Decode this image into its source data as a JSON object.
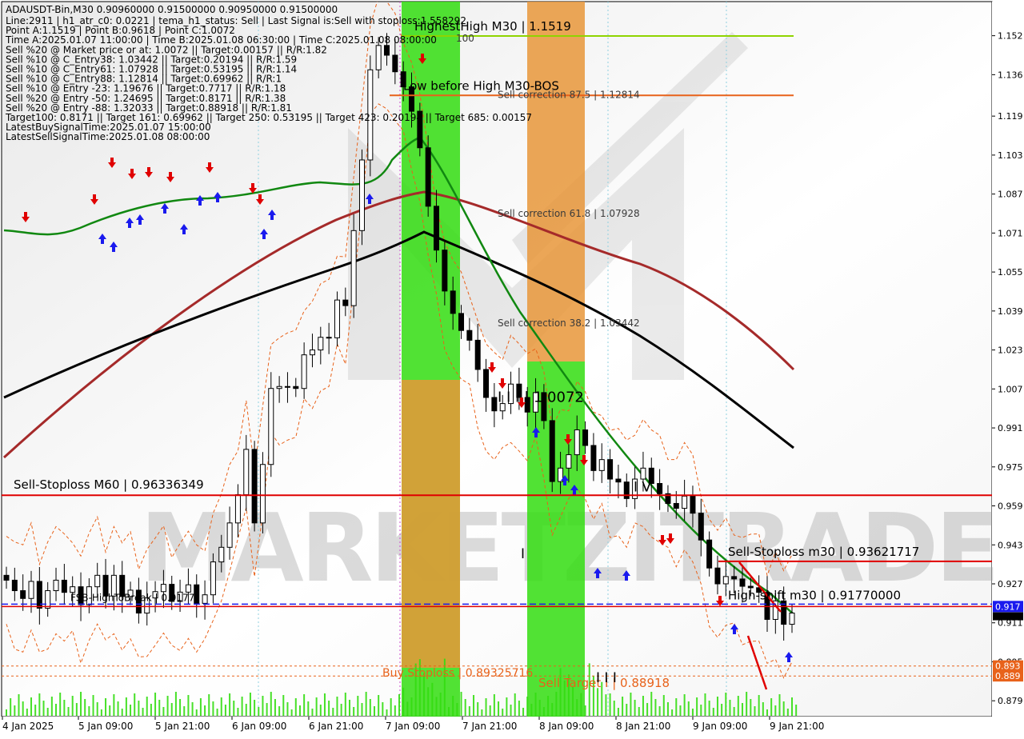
{
  "chart_data": {
    "type": "candlestick",
    "symbol_line": "ADAUSDT-Bin,M30  0.90960000 0.91500000 0.90950000 0.91500000",
    "info_lines": [
      "Line:2911 | h1_atr_c0: 0.0221 | tema_h1_status: Sell | Last Signal is:Sell with stoploss:1.558292",
      "Point A:1.1519 | Point B:0.9618 | Point C:1.0072",
      "Time A:2025.01.07 11:00:00 | Time B:2025.01.08 06:30:00 | Time C:2025.01.08 08:00:00",
      "Sell %20 @ Market price or at: 1.0072 || Target:0.00157 || R/R:1.82",
      "Sell %10 @ C_Entry38: 1.03442 || Target:0.20194 || R/R:1.59",
      "Sell %10 @ C_Entry61: 1.07928 || Target:0.53195 || R/R:1.14",
      "Sell %10 @ C_Entry88: 1.12814 || Target:0.69962 || R/R:1",
      "Sell %10 @ Entry -23: 1.19676 || Target:0.7717 || R/R:1.18",
      "Sell %20 @ Entry -50: 1.24695 || Target:0.8171 || R/R:1.38",
      "Sell %20 @ Entry -88: 1.32033 || Target:0.88918 || R/R:1.81",
      "Target100: 0.8171 || Target 161: 0.69962 || Target 250: 0.53195 || Target 423: 0.20194 || Target 685: 0.00157",
      "LatestBuySignalTime:2025.01.07 15:00:00",
      "LatestSellSignalTime:2025.01.08 08:00:00"
    ],
    "y_ticks": [
      "1.152",
      "1.136",
      "1.119",
      "1.103",
      "1.087",
      "1.071",
      "1.055",
      "1.039",
      "1.023",
      "1.007",
      "0.991",
      "0.975",
      "0.959",
      "0.943",
      "0.927",
      "0.911",
      "0.895",
      "0.879"
    ],
    "y_range": [
      0.8725,
      1.166
    ],
    "x_ticks": [
      "4 Jan 2025",
      "5 Jan 09:00",
      "5 Jan 21:00",
      "6 Jan 09:00",
      "6 Jan 21:00",
      "7 Jan 09:00",
      "7 Jan 21:00",
      "8 Jan 09:00",
      "8 Jan 21:00",
      "9 Jan 09:00",
      "9 Jan 21:00"
    ],
    "current_price_label": "0.917",
    "price_tags": [
      {
        "label": "0.893",
        "price": 0.8933,
        "color": "#e8621a"
      },
      {
        "label": "0.889",
        "price": 0.8892,
        "color": "#e8621a"
      }
    ],
    "horizontal_levels": [
      {
        "label": "HighestHigh   M30 | 1.1519",
        "price": 1.1519,
        "color": "#8fd400"
      },
      {
        "label": "Low before High   M30-BOS",
        "price": 1.1275,
        "color": "#e8621a"
      },
      {
        "label": "Sell-Stoploss M60 | 0.96336349",
        "price": 0.96336,
        "color": "#e00000"
      },
      {
        "label": "Sell-Stoploss m30 | 0.93621717",
        "price": 0.93622,
        "color": "#e00000"
      },
      {
        "label": "High-shift m30 | 0.91770000",
        "price": 0.9177,
        "color": "#e00000"
      },
      {
        "label": "FSB-HighToBreak | 0.9177",
        "price": 0.9177,
        "color": "#1a1aee"
      },
      {
        "label": "Buy Stoploss | 0.89325716",
        "price": 0.89326,
        "color": "#e8621a"
      },
      {
        "label": "Sell Target I | 0.88918",
        "price": 0.88918,
        "color": "#e8621a"
      }
    ],
    "fib_levels": [
      {
        "label": "Sell correction 87.5 | 1.12814",
        "price": 1.12814
      },
      {
        "label": "Sell correction 61.8 | 1.07928",
        "price": 1.07928
      },
      {
        "label": "Sell correction 38.2 | 1.03442",
        "price": 1.03442
      }
    ],
    "wave_labels": [
      {
        "label": "I I I | 1.0072",
        "price": 1.0072
      },
      {
        "label": "I V",
        "price": 0.9715
      },
      {
        "label": "I",
        "price": 0.9415
      },
      {
        "label": "I I I",
        "price": 0.8905
      }
    ],
    "green_zone_100_label": "100",
    "close_price_series": [
      0.9285,
      0.9242,
      0.921,
      0.928,
      0.917,
      0.9242,
      0.9285,
      0.9235,
      0.9258,
      0.9184,
      0.9258,
      0.9305,
      0.922,
      0.9305,
      0.9218,
      0.9244,
      0.915,
      0.9212,
      0.9238,
      0.9268,
      0.9198,
      0.9236,
      0.9266,
      0.919,
      0.9225,
      0.936,
      0.942,
      0.952,
      0.9636,
      0.9822,
      0.952,
      0.976,
      1.0072,
      1.008,
      1.008,
      1.0072,
      1.021,
      1.023,
      1.0282,
      1.028,
      1.0435,
      1.0412,
      1.072,
      1.101,
      1.138,
      1.148,
      1.144,
      1.1372,
      1.131,
      1.121,
      1.106,
      1.082,
      1.064,
      1.0472,
      1.038,
      1.031,
      1.027,
      1.015,
      1.0035,
      0.998,
      1.001,
      1.009,
      1.0035,
      0.9975,
      1.0055,
      0.994,
      0.969,
      0.9745,
      0.98,
      0.9902,
      0.9838,
      0.9735,
      0.978,
      0.97,
      0.9688,
      0.962,
      0.97,
      0.9745,
      0.9682,
      0.964,
      0.96,
      0.958,
      0.963,
      0.956,
      0.945,
      0.9335,
      0.927,
      0.93,
      0.929,
      0.926,
      0.9254,
      0.9235,
      0.9124,
      0.92,
      0.9104,
      0.915
    ]
  },
  "watermark": "MARKETZITRADE"
}
